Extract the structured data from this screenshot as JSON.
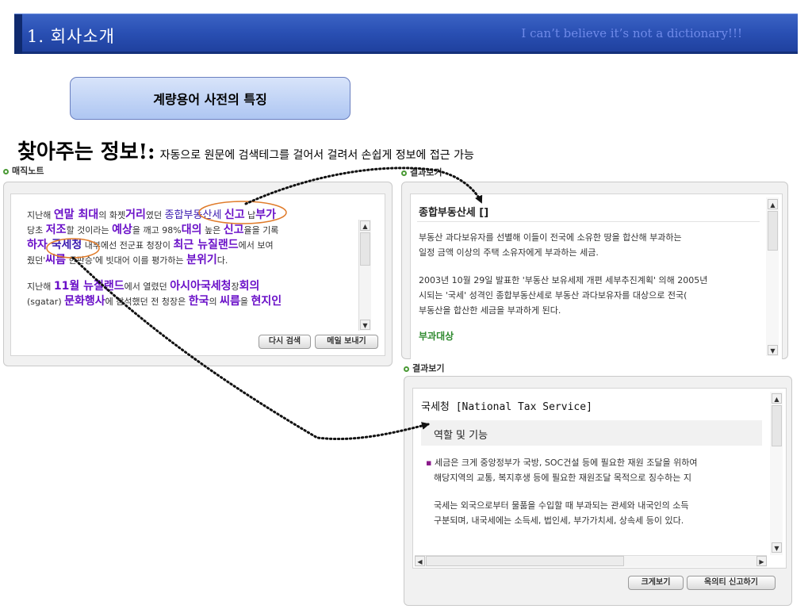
{
  "banner": {
    "title": "1. 회사소개",
    "slogan": "I can’t believe it’s not a dictionary!!!"
  },
  "subtitle": "계량용어 사전의 특징",
  "headline": {
    "main": "찾아주는 정보!:",
    "desc": "자동으로 원문에 검색테그를 걸어서 걸려서 손쉽게 정보에 접근 가능"
  },
  "magic_note": {
    "label": "매직노트",
    "p1": {
      "l1": [
        "지난해 ",
        "연말 최대",
        "의 화젯",
        "거리",
        "였던 ",
        "종합부동산세",
        " ",
        "신고",
        " 납",
        "부가"
      ],
      "l2": [
        "당초 ",
        "저조",
        "할 것이라는 ",
        "예상",
        "을 깨고 98%",
        "대의",
        " 높은 ",
        "신고",
        "율을 기록"
      ],
      "l3": [
        "하자 ",
        "국세청",
        " 내부에선 전군표 청장이 ",
        "최근 뉴질랜드",
        "에서 보여"
      ],
      "l4": [
        "줬던'",
        "씨름",
        " 한판승'에 빗대어 이를 평가하는 ",
        "분위기",
        "다."
      ]
    },
    "p2": {
      "l1": [
        "지난해 ",
        "11월 뉴질랜드",
        "에서 열렸던 ",
        "아시아국세청",
        "장",
        "회의"
      ],
      "l2": [
        "(sgatar) ",
        "문화행사",
        "에 참석했던 전 청장은 ",
        "한국",
        "의 ",
        "씨름",
        "을 ",
        "현지인"
      ]
    },
    "buttons": {
      "research": "다시 검색",
      "email": "메일 보내기"
    }
  },
  "result1": {
    "label": "결과보기",
    "title": "종합부동산세 []",
    "p1": [
      "부동산 과다보유자를 선별해 이들이 전국에 소유한 땅을 합산해 부과하는",
      "일정 금액 이상의 주택 소유자에게 부과하는 세금."
    ],
    "p2": [
      "2003년 10월 29일 발표한 '부동산 보유세제 개편 세부추진계획' 의해 2005년",
      "시되는 '국세' 성격인 종합부동산세로 부동산 과다보유자를 대상으로 전국(",
      "부동산을 합산한 세금을 부과하게 된다."
    ],
    "section": "부과대상"
  },
  "result2": {
    "label": "결과보기",
    "title": "국세청 [National Tax Service]",
    "subhead": "역할 및 기능",
    "p1": [
      "세금은 크게 중앙정부가 국방, SOC건설 등에 필요한 재원 조달을 위하여",
      "해당지역의 교통, 복지후생 등에 필요한 재원조달 목적으로 징수하는 지"
    ],
    "p2": [
      "국세는 외국으로부터 물품을 수입할 때 부과되는 관세와 내국인의 소득",
      "구분되며, 내국세에는 소득세, 법인세, 부가가치세, 상속세 등이 있다."
    ],
    "buttons": {
      "enlarge": "크게보기",
      "report": "옥의티 신고하기"
    }
  },
  "colors": {
    "banner": "#2a50b4",
    "keyword": "#6a10c8",
    "highlight_ring": "#e07b2a",
    "section_green": "#2f8a2f"
  },
  "icons": {
    "scroll_up": "▲",
    "scroll_down": "▼",
    "scroll_left": "◀",
    "scroll_right": "▶"
  }
}
